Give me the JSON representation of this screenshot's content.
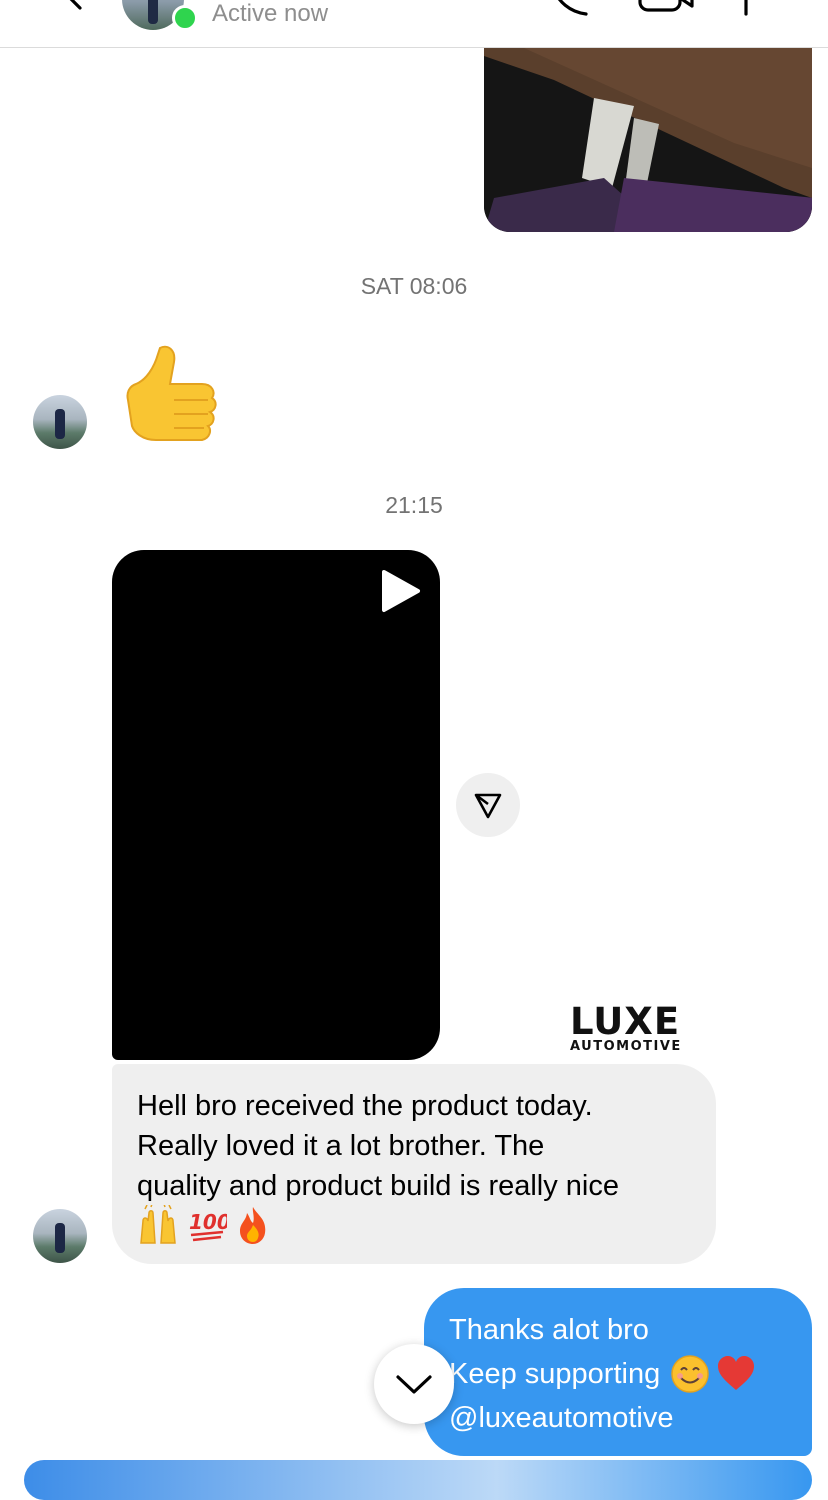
{
  "header": {
    "status": "Active now",
    "online_color": "#2fd44e"
  },
  "messages": {
    "timestamp_1": "SAT 08:06",
    "timestamp_2": "21:15",
    "received_emoji": "👍",
    "video_watermark": {
      "main": "LUXE",
      "sub": "AUTOMOTIVE"
    },
    "received_text": {
      "line1": "Hell bro received the product today.",
      "line2": "Really loved it a lot brother. The",
      "line3": "quality and product build is really nice",
      "emojis": [
        "🙌",
        "💯",
        "🔥"
      ]
    },
    "sent_text": {
      "line1": "Thanks alot bro",
      "line2": "Keep supporting",
      "line2_emojis": [
        "😊",
        "❤️"
      ],
      "line3": "@luxeautomotive"
    }
  },
  "colors": {
    "sent_bubble": "#3797f0",
    "received_bubble": "#efefef",
    "timestamp": "#737373"
  },
  "icons": [
    "back-icon",
    "call-icon",
    "video-call-icon",
    "info-icon",
    "play-icon",
    "share-icon",
    "chevron-down-icon"
  ]
}
